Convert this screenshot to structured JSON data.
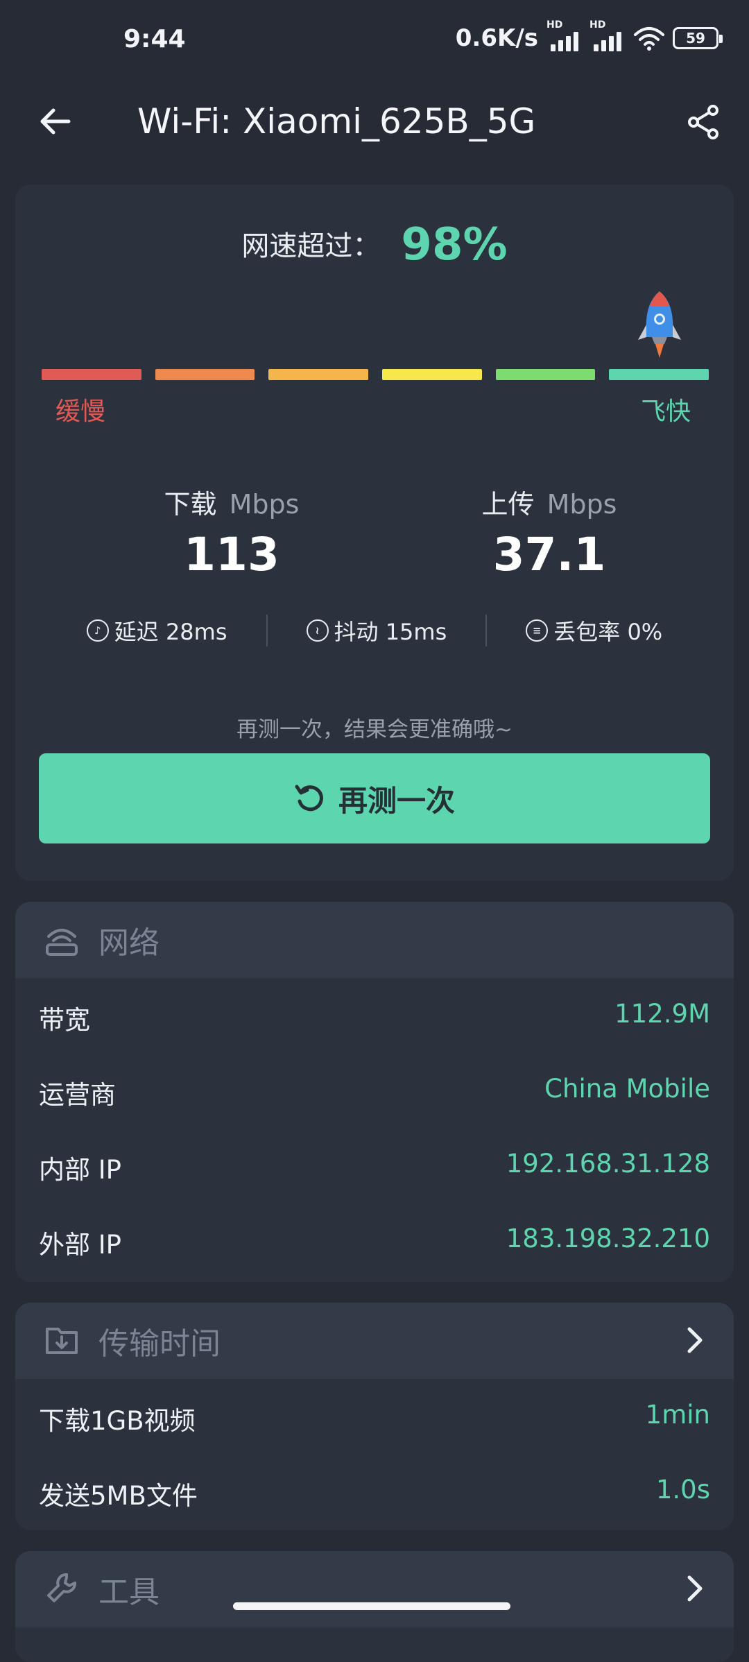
{
  "status_bar": {
    "time": "9:44",
    "net_speed": "0.6K/s",
    "signal_1_label": "HD",
    "signal_2_label": "HD",
    "battery": "59"
  },
  "app_bar": {
    "title": "Wi-Fi: Xiaomi_625B_5G",
    "back_icon": "arrow-left-icon",
    "share_icon": "share-icon"
  },
  "result": {
    "percent_label": "网速超过：",
    "percent_value": "98%",
    "scale_slow": "缓慢",
    "scale_fast": "飞快",
    "scale_colors": [
      "#e25a55",
      "#ef8a4e",
      "#f4b54a",
      "#f6e84a",
      "#7ddc6e",
      "#5dd6b0"
    ],
    "download_label": "下载",
    "download_unit": "Mbps",
    "download_value": "113",
    "upload_label": "上传",
    "upload_unit": "Mbps",
    "upload_value": "37.1",
    "latency": "延迟 28ms",
    "jitter": "抖动 15ms",
    "packet_loss": "丢包率 0%",
    "hint": "再测一次，结果会更准确哦~",
    "retest_label": "再测一次"
  },
  "network": {
    "title": "网络",
    "rows": [
      {
        "key": "带宽",
        "value": "112.9M"
      },
      {
        "key": "运营商",
        "value": "China Mobile"
      },
      {
        "key": "内部 IP",
        "value": "192.168.31.128"
      },
      {
        "key": "外部 IP",
        "value": "183.198.32.210"
      }
    ]
  },
  "transfer": {
    "title": "传输时间",
    "rows": [
      {
        "key": "下载1GB视频",
        "value": "1min"
      },
      {
        "key": "发送5MB文件",
        "value": "1.0s"
      }
    ]
  },
  "tools": {
    "title": "工具"
  },
  "colors": {
    "accent": "#5dd6b0",
    "background": "#262b36",
    "card": "#2b313d"
  }
}
